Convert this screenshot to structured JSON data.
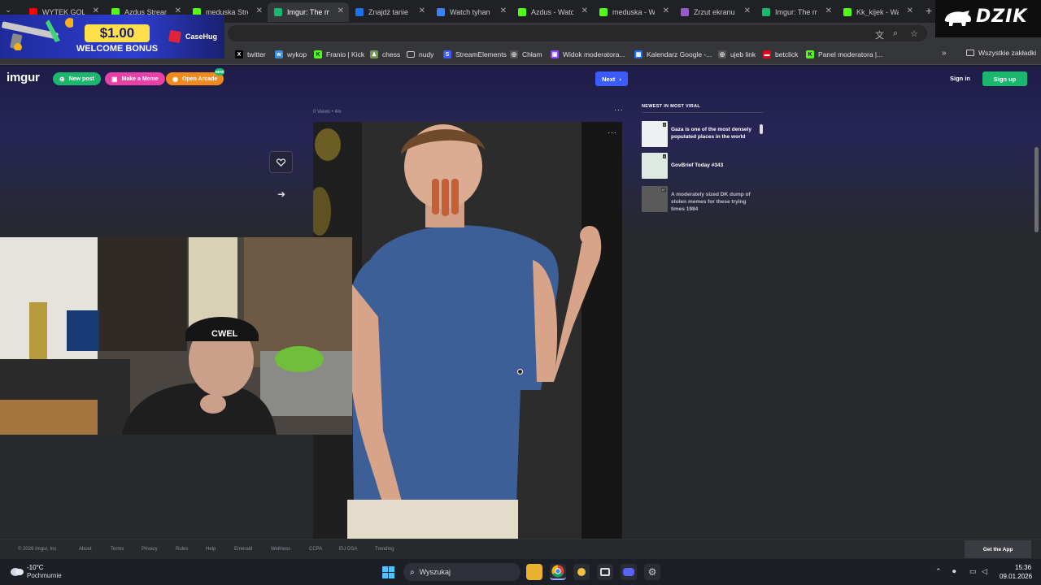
{
  "browser": {
    "tabs": [
      {
        "label": "WYTEK GOL",
        "favicon_color": "#ff0000",
        "active": false
      },
      {
        "label": "Azdus Stream",
        "favicon_color": "#53fc18",
        "active": false
      },
      {
        "label": "meduska Strea",
        "favicon_color": "#53fc18",
        "active": false
      },
      {
        "label": "Imgur: The ma",
        "favicon_color": "#1bb76e",
        "active": true
      },
      {
        "label": "Znajdź tanie lo",
        "favicon_color": "#1a73e8",
        "active": false
      },
      {
        "label": "Watch tyhan |",
        "favicon_color": "#3b82f6",
        "active": false
      },
      {
        "label": "Azdus - Watch",
        "favicon_color": "#53fc18",
        "active": false
      },
      {
        "label": "meduska - Wa",
        "favicon_color": "#53fc18",
        "active": false
      },
      {
        "label": "Zrzut ekranu z",
        "favicon_color": "#9b59d0",
        "active": false
      },
      {
        "label": "Imgur: The ma",
        "favicon_color": "#1bb76e",
        "active": false
      },
      {
        "label": "Kk_kijek - Wat",
        "favicon_color": "#53fc18",
        "active": false
      }
    ],
    "bookmarks": [
      {
        "label": "twitter",
        "icon": "x-icon",
        "color": "#000000",
        "glyph": "X"
      },
      {
        "label": "wykop",
        "icon": "wykop-icon",
        "color": "#3a8fd8",
        "glyph": "w"
      },
      {
        "label": "Franio | Kick",
        "icon": "kick-icon",
        "color": "#53fc18",
        "glyph": "K"
      },
      {
        "label": "chess",
        "icon": "chess-icon",
        "color": "#769656",
        "glyph": "♟"
      },
      {
        "label": "nudy",
        "icon": "folder-icon",
        "color": "#35363a",
        "glyph": ""
      },
      {
        "label": "StreamElements",
        "icon": "streamelements-icon",
        "color": "#3b5bfa",
        "glyph": "S"
      },
      {
        "label": "Chłam",
        "icon": "globe-icon",
        "color": "#555555",
        "glyph": "◎"
      },
      {
        "label": "Widok moderatora...",
        "icon": "twitch-icon",
        "color": "#9146ff",
        "glyph": "▣"
      },
      {
        "label": "Kalendarz Google -...",
        "icon": "calendar-icon",
        "color": "#1a73e8",
        "glyph": "▦"
      },
      {
        "label": "ujeb link",
        "icon": "globe-icon",
        "color": "#555555",
        "glyph": "◎"
      },
      {
        "label": "betclick",
        "icon": "betclic-icon",
        "color": "#e2001a",
        "glyph": "▬"
      },
      {
        "label": "Panel moderatora |...",
        "icon": "kick-icon",
        "color": "#53fc18",
        "glyph": "K"
      }
    ],
    "bookmarks_all": "Wszystkie zakładki"
  },
  "ad": {
    "amount": "$1.00",
    "text": "WELCOME BONUS",
    "brand": "CaseHug"
  },
  "stream_logo": "DZIK",
  "imgur": {
    "logo": "imgur",
    "new_post": "New post",
    "make_meme": "Make a Meme",
    "open_arcade": "Open Arcade",
    "arcade_badge": "NEW",
    "next": "Next",
    "sign_in": "Sign in",
    "sign_up": "Sign up",
    "post_meta": "0 Views • 4m",
    "sidebar_title": "NEWEST IN MOST VIRAL",
    "viral_items": [
      {
        "title": "Gaza is one of the most densely populated places in the world",
        "count": "2"
      },
      {
        "title": "GovBrief Today #343",
        "count": "4"
      },
      {
        "title": "A moderately sized DK dump of stolen memes for these trying times 1984",
        "count": "47"
      }
    ],
    "footer": [
      "© 2026 Imgur, Inc",
      "About",
      "Terms",
      "Privacy",
      "Rules",
      "Help",
      "Emerald",
      "Wellness",
      "CCPA",
      "EU DSA",
      "Trending"
    ],
    "get_app": "Get the App"
  },
  "taskbar": {
    "temperature": "-10°C",
    "weather": "Pochmurnie",
    "search_placeholder": "Wyszukaj",
    "time": "15:36",
    "date": "09.01.2026"
  }
}
